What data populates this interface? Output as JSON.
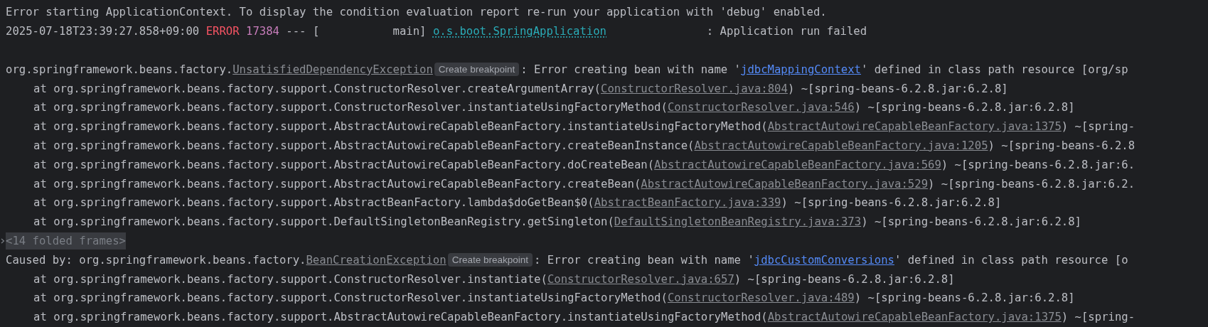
{
  "console": {
    "lines": [
      {
        "kind": "plain",
        "text": "Error starting ApplicationContext. To display the condition evaluation report re-run your application with 'debug' enabled."
      },
      {
        "kind": "log",
        "timestamp": "2025-07-18T23:39:27.858+09:00",
        "level": "ERROR",
        "pid": "17384",
        "thread": "--- [           main]",
        "logger": "o.s.boot.SpringApplication",
        "message": "               : Application run failed"
      },
      {
        "kind": "blank"
      },
      {
        "kind": "exception",
        "prefix": "org.springframework.beans.factory.",
        "exception": "UnsatisfiedDependencyException",
        "badge": "Create breakpoint",
        "before": ": Error creating bean with name '",
        "bean": "jdbcMappingContext",
        "after": "' defined in class path resource [org/sp"
      },
      {
        "kind": "frame",
        "call": "at org.springframework.beans.factory.support.ConstructorResolver.createArgumentArray(",
        "source": "ConstructorResolver.java:804",
        "suffix": ") ~[spring-beans-6.2.8.jar:6.2.8]"
      },
      {
        "kind": "frame",
        "call": "at org.springframework.beans.factory.support.ConstructorResolver.instantiateUsingFactoryMethod(",
        "source": "ConstructorResolver.java:546",
        "suffix": ") ~[spring-beans-6.2.8.jar:6.2.8]"
      },
      {
        "kind": "frame",
        "call": "at org.springframework.beans.factory.support.AbstractAutowireCapableBeanFactory.instantiateUsingFactoryMethod(",
        "source": "AbstractAutowireCapableBeanFactory.java:1375",
        "suffix": ") ~[spring-"
      },
      {
        "kind": "frame",
        "call": "at org.springframework.beans.factory.support.AbstractAutowireCapableBeanFactory.createBeanInstance(",
        "source": "AbstractAutowireCapableBeanFactory.java:1205",
        "suffix": ") ~[spring-beans-6.2.8"
      },
      {
        "kind": "frame",
        "call": "at org.springframework.beans.factory.support.AbstractAutowireCapableBeanFactory.doCreateBean(",
        "source": "AbstractAutowireCapableBeanFactory.java:569",
        "suffix": ") ~[spring-beans-6.2.8.jar:6."
      },
      {
        "kind": "frame",
        "call": "at org.springframework.beans.factory.support.AbstractAutowireCapableBeanFactory.createBean(",
        "source": "AbstractAutowireCapableBeanFactory.java:529",
        "suffix": ") ~[spring-beans-6.2.8.jar:6.2."
      },
      {
        "kind": "frame",
        "call": "at org.springframework.beans.factory.support.AbstractBeanFactory.lambda$doGetBean$0(",
        "source": "AbstractBeanFactory.java:339",
        "suffix": ") ~[spring-beans-6.2.8.jar:6.2.8]"
      },
      {
        "kind": "frame",
        "call": "at org.springframework.beans.factory.support.DefaultSingletonBeanRegistry.getSingleton(",
        "source": "DefaultSingletonBeanRegistry.java:373",
        "suffix": ") ~[spring-beans-6.2.8.jar:6.2.8]"
      },
      {
        "kind": "folded",
        "text": "<14 folded frames>",
        "expanded": false
      },
      {
        "kind": "exception",
        "prefix": "Caused by: org.springframework.beans.factory.",
        "exception": "BeanCreationException",
        "badge": "Create breakpoint",
        "before": ": Error creating bean with name '",
        "bean": "jdbcCustomConversions",
        "after": "' defined in class path resource [o"
      },
      {
        "kind": "frame",
        "call": "at org.springframework.beans.factory.support.ConstructorResolver.instantiate(",
        "source": "ConstructorResolver.java:657",
        "suffix": ") ~[spring-beans-6.2.8.jar:6.2.8]"
      },
      {
        "kind": "frame",
        "call": "at org.springframework.beans.factory.support.ConstructorResolver.instantiateUsingFactoryMethod(",
        "source": "ConstructorResolver.java:489",
        "suffix": ") ~[spring-beans-6.2.8.jar:6.2.8]"
      },
      {
        "kind": "frame",
        "call": "at org.springframework.beans.factory.support.AbstractAutowireCapableBeanFactory.instantiateUsingFactoryMethod(",
        "source": "AbstractAutowireCapableBeanFactory.java:1375",
        "suffix": ") ~[spring-"
      }
    ]
  }
}
